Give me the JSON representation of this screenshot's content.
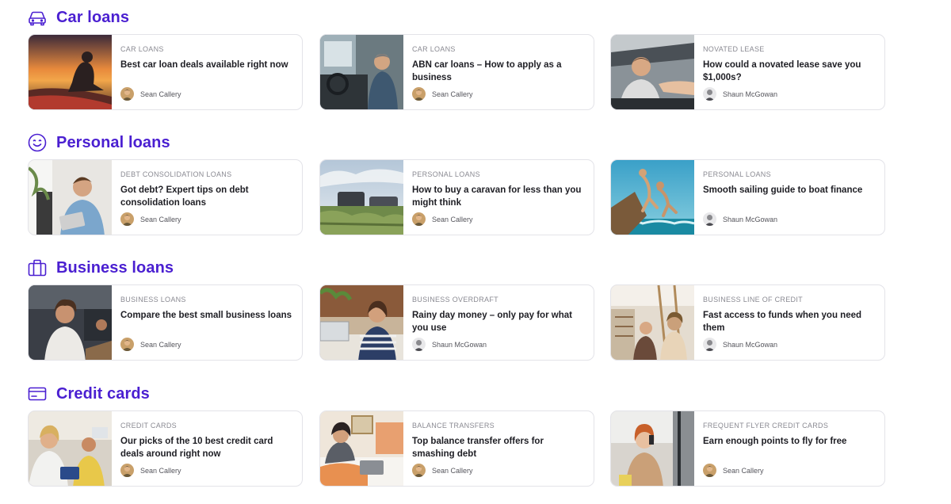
{
  "sections": [
    {
      "title": "Car loans",
      "icon": "car-icon",
      "cards": [
        {
          "category": "CAR LOANS",
          "title": "Best car loan deals available right now",
          "author": "Sean Callery",
          "image": "sunset-car-roof-photo"
        },
        {
          "category": "CAR LOANS",
          "title": "ABN car loans – How to apply as a business",
          "author": "Sean Callery",
          "image": "man-in-van-photo"
        },
        {
          "category": "NOVATED LEASE",
          "title": "How could a novated lease save you $1,000s?",
          "author": "Shaun McGowan",
          "image": "man-receiving-keys-photo"
        }
      ]
    },
    {
      "title": "Personal loans",
      "icon": "smiley-icon",
      "cards": [
        {
          "category": "DEBT CONSOLIDATION LOANS",
          "title": "Got debt? Expert tips on debt consolidation loans",
          "author": "Sean Callery",
          "image": "man-with-tablet-photo"
        },
        {
          "category": "PERSONAL LOANS",
          "title": "How to buy a caravan for less than you might think",
          "author": "Sean Callery",
          "image": "caravan-field-photo"
        },
        {
          "category": "PERSONAL LOANS",
          "title": "Smooth sailing guide to boat finance",
          "author": "Shaun McGowan",
          "image": "boat-jump-photo"
        }
      ]
    },
    {
      "title": "Business loans",
      "icon": "briefcase-icon",
      "cards": [
        {
          "category": "BUSINESS LOANS",
          "title": "Compare the best small business loans",
          "author": "Sean Callery",
          "image": "cafe-owner-photo"
        },
        {
          "category": "BUSINESS OVERDRAFT",
          "title": "Rainy day money – only pay for what you use",
          "author": "Shaun McGowan",
          "image": "woman-at-laptop-photo"
        },
        {
          "category": "BUSINESS LINE OF CREDIT",
          "title": "Fast access to funds when you need them",
          "author": "Shaun McGowan",
          "image": "shop-interior-photo"
        }
      ]
    },
    {
      "title": "Credit cards",
      "icon": "credit-card-icon",
      "cards": [
        {
          "category": "CREDIT CARDS",
          "title": "Our picks of the 10 best credit card deals around right now",
          "author": "Sean Callery",
          "image": "friends-paying-photo"
        },
        {
          "category": "BALANCE TRANSFERS",
          "title": "Top balance transfer offers for smashing debt",
          "author": "Sean Callery",
          "image": "woman-on-laptop-bed-photo"
        },
        {
          "category": "FREQUENT FLYER CREDIT CARDS",
          "title": "Earn enough points to fly for free",
          "author": "Sean Callery",
          "image": "woman-airport-phone-photo"
        }
      ]
    }
  ],
  "colors": {
    "accent": "#4a1fd1",
    "title_text": "#1e1e24",
    "category_text": "#8a8a92",
    "border": "#e3e3e8"
  }
}
